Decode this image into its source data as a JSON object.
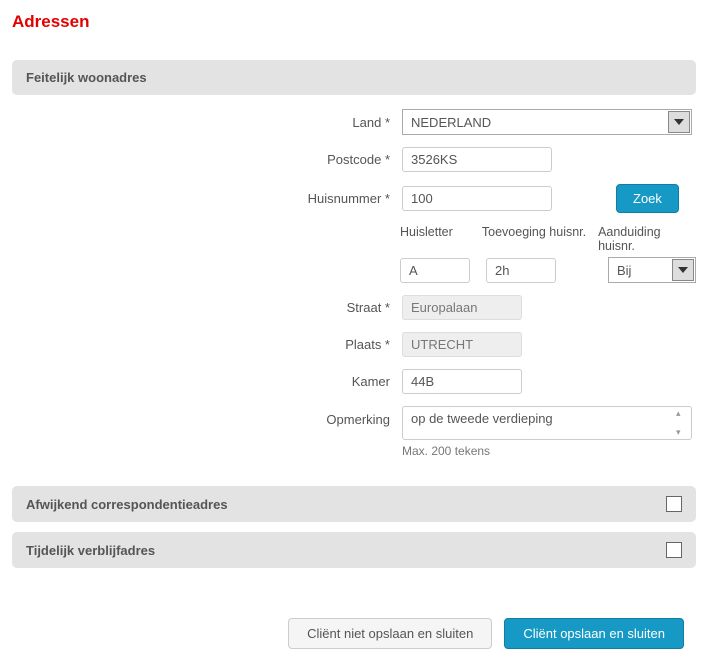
{
  "page_title": "Adressen",
  "sections": {
    "feitelijk": {
      "title": "Feitelijk woonadres",
      "fields": {
        "land_label": "Land *",
        "land_value": "NEDERLAND",
        "postcode_label": "Postcode *",
        "postcode_value": "3526KS",
        "huisnummer_label": "Huisnummer *",
        "huisnummer_value": "100",
        "zoek_label": "Zoek",
        "huisletter_label": "Huisletter",
        "huisletter_value": "A",
        "toevoeging_label": "Toevoeging huisnr.",
        "toevoeging_value": "2h",
        "aanduiding_label": "Aanduiding huisnr.",
        "aanduiding_value": "Bij",
        "straat_label": "Straat *",
        "straat_value": "Europalaan",
        "plaats_label": "Plaats *",
        "plaats_value": "UTRECHT",
        "kamer_label": "Kamer",
        "kamer_value": "44B",
        "opmerking_label": "Opmerking",
        "opmerking_value": "op de tweede verdieping",
        "opmerking_hint": "Max. 200 tekens"
      }
    },
    "afwijkend": {
      "title": "Afwijkend correspondentieadres"
    },
    "tijdelijk": {
      "title": "Tijdelijk verblijfadres"
    }
  },
  "buttons": {
    "cancel": "Cliënt niet opslaan en sluiten",
    "save": "Cliënt opslaan en sluiten"
  }
}
